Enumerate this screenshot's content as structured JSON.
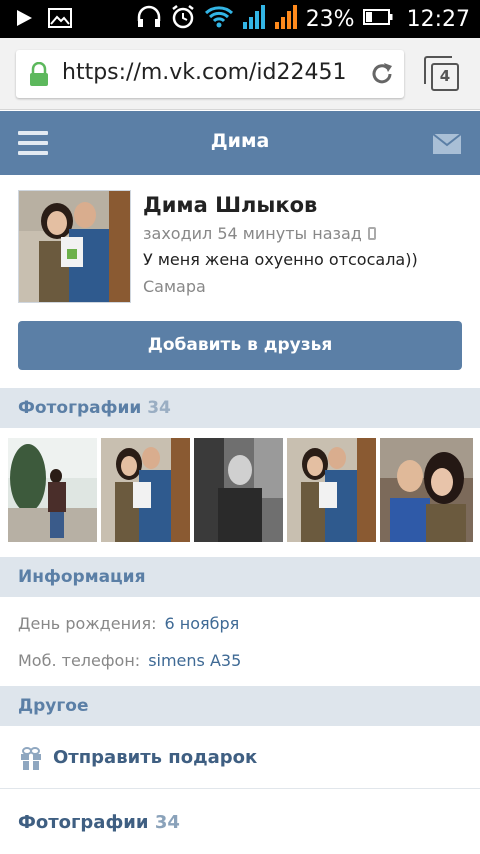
{
  "statusbar": {
    "battery_percent": "23%",
    "time": "12:27"
  },
  "browser": {
    "url": "https://m.vk.com/id22451",
    "tab_count": "4"
  },
  "header": {
    "title": "Дима"
  },
  "profile": {
    "name": "Дима Шлыков",
    "last_seen": "заходил 54 минуты назад",
    "status": "У меня жена охуенно отсосала))",
    "city": "Самара",
    "add_friend_label": "Добавить в друзья"
  },
  "photos": {
    "title": "Фотографии",
    "count": "34"
  },
  "info": {
    "title": "Информация",
    "birthday_label": "День рождения:",
    "birthday_value": "6 ноября",
    "phone_label": "Моб. телефон:",
    "phone_value": "simens A35"
  },
  "other": {
    "title": "Другое",
    "gift_label": "Отправить подарок",
    "photos_label": "Фотографии",
    "photos_count": "34"
  },
  "colors": {
    "vk_blue": "#5b7fa6",
    "section_bg": "#dee5ec",
    "link_blue": "#3f6a95"
  }
}
